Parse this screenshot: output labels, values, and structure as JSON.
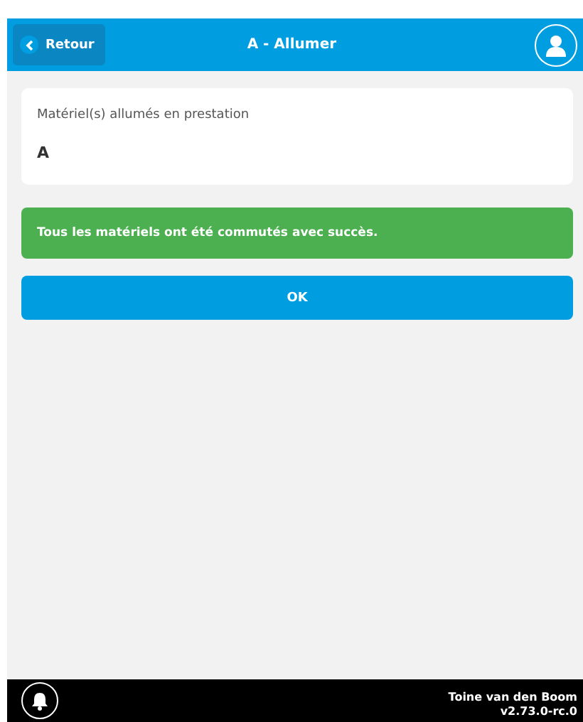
{
  "header": {
    "back_button": "Retour",
    "title": "A - Allumer"
  },
  "card": {
    "label": "Matériel(s) allumés en prestation",
    "value": "A"
  },
  "alert": {
    "kind": "success",
    "text": "Tous les matériels ont été commutés avec succès."
  },
  "ok_button": "OK",
  "footer": {
    "user": "Toine van den Boom",
    "version": "v2.73.0-rc.0"
  }
}
